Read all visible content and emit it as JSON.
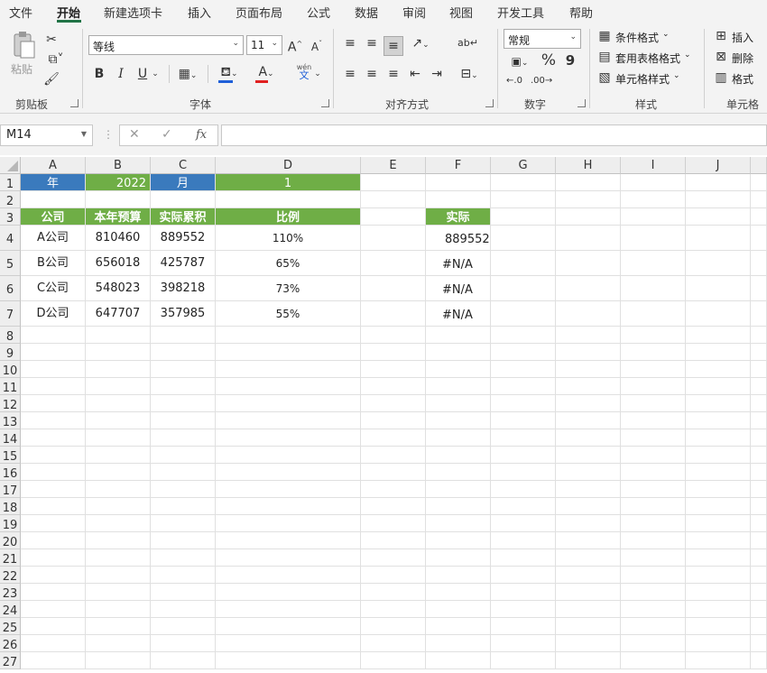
{
  "menu": {
    "items": [
      "文件",
      "开始",
      "新建选项卡",
      "插入",
      "页面布局",
      "公式",
      "数据",
      "审阅",
      "视图",
      "开发工具",
      "帮助"
    ],
    "active_index": 1
  },
  "ribbon": {
    "clipboard": {
      "label": "剪贴板",
      "paste": "粘贴"
    },
    "font": {
      "label": "字体",
      "font_name": "等线",
      "font_size": "11",
      "bold": "B",
      "italic": "I",
      "underline": "U",
      "phonetic_top": "wén",
      "phonetic_bottom": "文"
    },
    "alignment": {
      "label": "对齐方式"
    },
    "number": {
      "label": "数字",
      "format": "常规",
      "percent": "%",
      "comma": "9"
    },
    "styles": {
      "label": "样式",
      "conditional": "条件格式",
      "table_format": "套用表格格式",
      "cell_styles": "单元格样式"
    },
    "cells": {
      "label": "单元格",
      "insert": "插入",
      "delete": "删除",
      "format": "格式"
    }
  },
  "formula_bar": {
    "name_box": "M14",
    "fx": "fx",
    "cancel": "✕",
    "enter": "✓",
    "value": ""
  },
  "sheet": {
    "columns": [
      "A",
      "B",
      "C",
      "D",
      "E",
      "F",
      "G",
      "H",
      "I",
      "J"
    ],
    "rows": [
      "1",
      "2",
      "3",
      "4",
      "5",
      "6",
      "7",
      "8",
      "9",
      "10",
      "11",
      "12",
      "13",
      "14",
      "15",
      "16",
      "17",
      "18",
      "19",
      "20",
      "21",
      "22",
      "23",
      "24",
      "25",
      "26",
      "27"
    ],
    "header_colors": {
      "blue": "#3a7abd",
      "green": "#6fae46"
    },
    "cells": {
      "A1": "年",
      "B1": "2022",
      "C1": "月",
      "D1": "1",
      "A3": "公司",
      "B3": "本年预算",
      "C3": "实际累积",
      "D3": "比例",
      "F3": "实际",
      "A4": "A公司",
      "B4": "810460",
      "C4": "889552",
      "D4": "110%",
      "F4": "889552",
      "A5": "B公司",
      "B5": "656018",
      "C5": "425787",
      "D5": "65%",
      "F5": "#N/A",
      "A6": "C公司",
      "B6": "548023",
      "C6": "398218",
      "D6": "73%",
      "F6": "#N/A",
      "A7": "D公司",
      "B7": "647707",
      "C7": "357985",
      "D7": "55%",
      "F7": "#N/A"
    }
  }
}
